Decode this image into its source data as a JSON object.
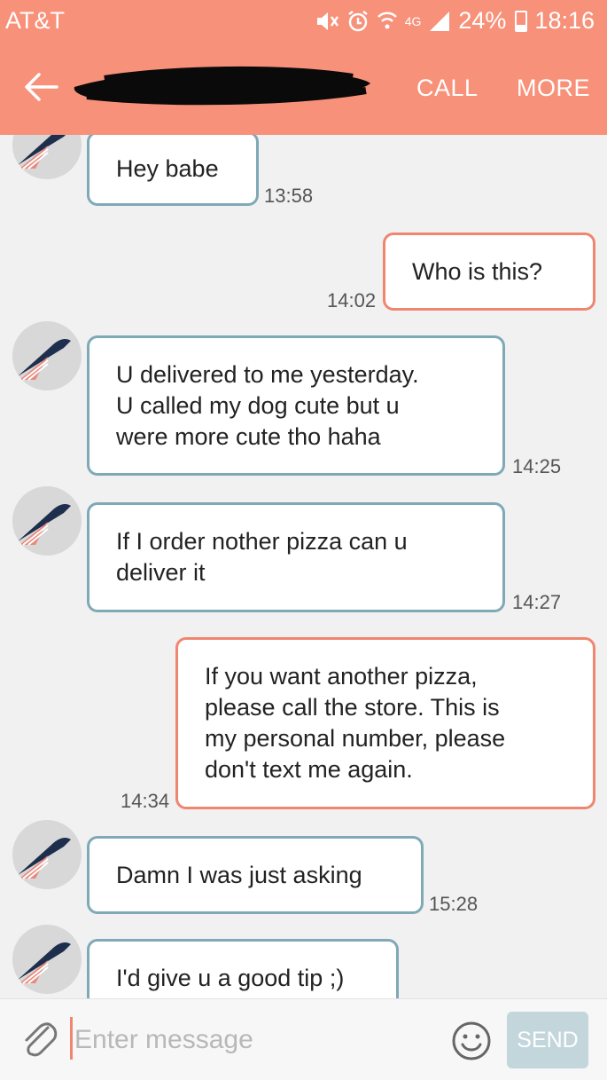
{
  "status_bar": {
    "carrier": "AT&T",
    "network": "4G",
    "battery": "24%",
    "time": "18:16"
  },
  "header": {
    "contact_name_redacted": "",
    "call_label": "CALL",
    "more_label": "MORE"
  },
  "messages": [
    {
      "direction": "in",
      "text": "Hey babe",
      "time": "13:58"
    },
    {
      "direction": "out",
      "text": "Who is this?",
      "time": "14:02"
    },
    {
      "direction": "in",
      "text": "U delivered to me yesterday.\nU called my dog cute but u\nwere more cute tho haha",
      "time": "14:25"
    },
    {
      "direction": "in",
      "text": "If I order nother pizza can u\ndeliver it",
      "time": "14:27"
    },
    {
      "direction": "out",
      "text": "If you want another pizza,\nplease call the store. This is\nmy personal number, please\ndon't text me again.",
      "time": "14:34"
    },
    {
      "direction": "in",
      "text": "Damn I was just asking",
      "time": "15:28"
    },
    {
      "direction": "in",
      "text": "I'd give u a good tip ;)",
      "time": ""
    }
  ],
  "composer": {
    "placeholder": "Enter message",
    "send_label": "SEND"
  },
  "colors": {
    "accent": "#f7917a",
    "incoming_border": "#7fa9b6",
    "outgoing_border": "#f0866f"
  },
  "icons": [
    "back-arrow-icon",
    "mute-icon",
    "alarm-icon",
    "wifi-icon",
    "signal-icon",
    "battery-icon",
    "attach-icon",
    "emoji-icon",
    "whale-avatar-icon"
  ]
}
